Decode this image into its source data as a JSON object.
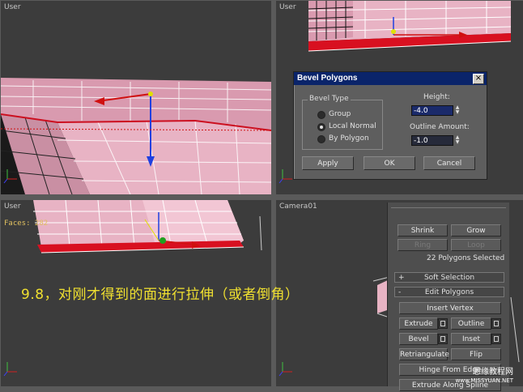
{
  "viewports": {
    "top_left": {
      "label": "User"
    },
    "top_right": {
      "label": "User"
    },
    "bottom_left": {
      "label": "User",
      "faces": "Faces: 282"
    },
    "bottom_right": {
      "label": "Camera01"
    }
  },
  "dialog": {
    "title": "Bevel Polygons",
    "close_label": "×",
    "bevel_type_label": "Bevel Type",
    "options": [
      "Group",
      "Local Normal",
      "By Polygon"
    ],
    "selected_option": "Local Normal",
    "height_label": "Height:",
    "height_value": "-4.0",
    "outline_label": "Outline Amount:",
    "outline_value": "-1.0",
    "apply_label": "Apply",
    "ok_label": "OK",
    "cancel_label": "Cancel"
  },
  "panel": {
    "shrink": "Shrink",
    "grow": "Grow",
    "ring": "Ring",
    "loop": "Loop",
    "selection_info": "22 Polygons Selected",
    "soft_selection": {
      "sign": "+",
      "label": "Soft Selection"
    },
    "edit_polygons": {
      "sign": "-",
      "label": "Edit Polygons"
    },
    "insert_vertex": "Insert Vertex",
    "extrude": "Extrude",
    "outline": "Outline",
    "bevel": "Bevel",
    "inset": "Inset",
    "retriangulate": "Retriangulate",
    "flip": "Flip",
    "hinge": "Hinge From Edge",
    "extrude_spline": "Extrude Along Spline"
  },
  "caption": "9.8，对刚才得到的面进行拉伸（或者倒角）",
  "watermark": {
    "line1": "思缘教程网",
    "line2": "www.MISSYUAN.NET"
  },
  "colors": {
    "mesh": "#e6a8bc",
    "selected_band": "#d81020",
    "viewport_bg": "#3c3c3c",
    "caption": "#f0e030",
    "dialog_title_bg": "#0a246a"
  }
}
